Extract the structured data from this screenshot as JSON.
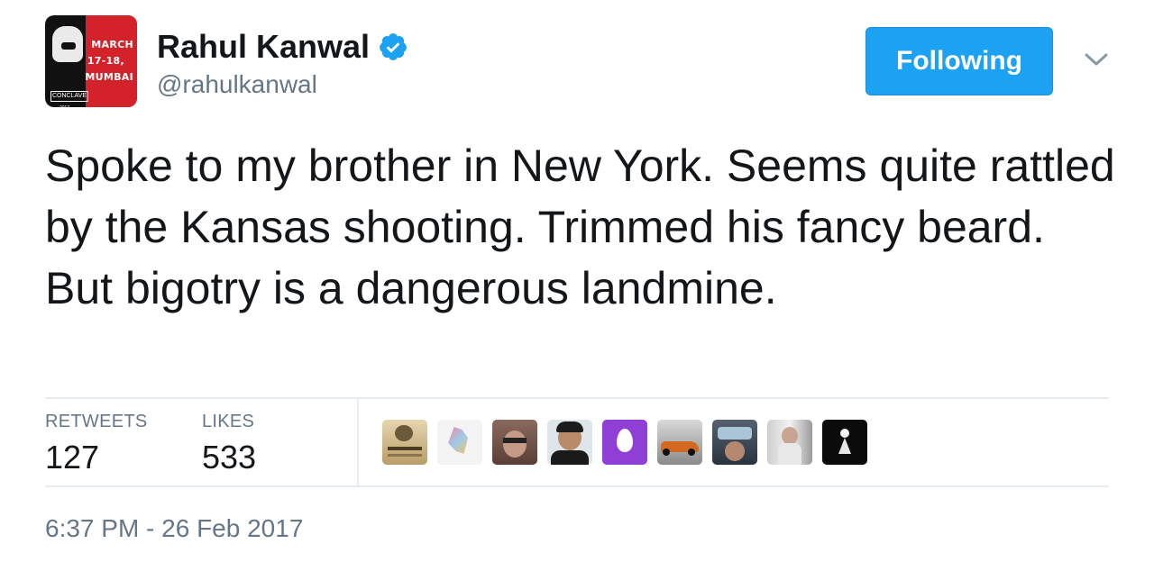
{
  "author": {
    "name": "Rahul Kanwal",
    "handle": "@rahulkanwal",
    "verified": true,
    "avatar_text": {
      "month": "MARCH",
      "dates": "17-18,",
      "city": "MUMBAI",
      "brand": "CONCLAVE",
      "year": "2017"
    }
  },
  "follow_button": {
    "label": "Following"
  },
  "tweet": {
    "text": "Spoke to my brother in New York. Seems quite rattled by the Kansas shooting. Trimmed his fancy beard. But bigotry is a dangerous landmine."
  },
  "stats": {
    "retweets_label": "RETWEETS",
    "retweets_value": "127",
    "likes_label": "LIKES",
    "likes_value": "533"
  },
  "timestamp": "6:37 PM - 26 Feb 2017",
  "colors": {
    "accent": "#1da1f2",
    "text": "#14171a",
    "muted": "#657786",
    "divider": "#e6ecf0"
  }
}
